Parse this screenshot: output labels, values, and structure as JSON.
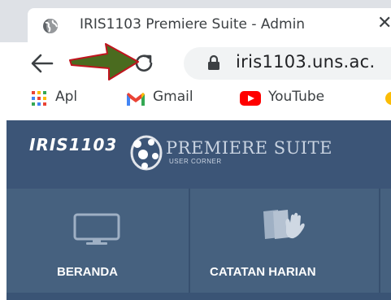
{
  "browser": {
    "tab": {
      "title": "IRIS1103 Premiere Suite - Admin",
      "close_symbol": "✕",
      "favicon_icon": "globe-icon"
    },
    "toolbar": {
      "back_icon": "back-arrow-icon",
      "reload_icon": "reload-icon",
      "lock_icon": "lock-icon",
      "url": "iris1103.uns.ac."
    },
    "bookmarks": [
      {
        "label": "Apl",
        "icon": "apps-grid-icon"
      },
      {
        "label": "Gmail",
        "icon": "gmail-icon"
      },
      {
        "label": "YouTube",
        "icon": "youtube-icon"
      }
    ]
  },
  "annotation": {
    "icon": "green-arrow-pointer",
    "color": "#4a6b1f",
    "border_color": "#c0141e"
  },
  "site": {
    "logo_text": "IRIS1103",
    "title": "PREMIERE SUITE",
    "subtitle": "USER CORNER",
    "colors": {
      "header_bg": "#3c5577",
      "tile_bg": "#46617f"
    },
    "nav": [
      {
        "label": "BERANDA",
        "icon": "monitor-icon"
      },
      {
        "label": "CATATAN HARIAN",
        "icon": "notes-hand-icon"
      }
    ]
  }
}
